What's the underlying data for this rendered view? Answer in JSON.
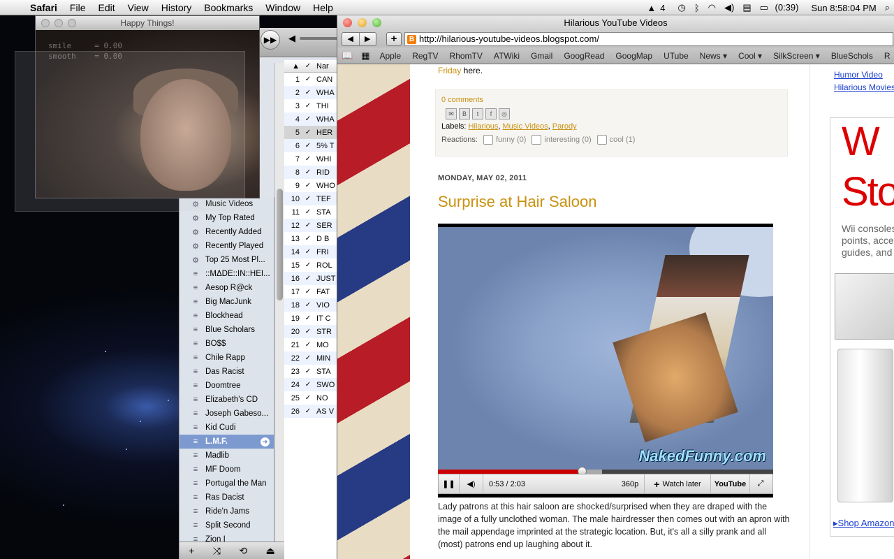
{
  "menubar": {
    "app": "Safari",
    "items": [
      "File",
      "Edit",
      "View",
      "History",
      "Bookmarks",
      "Window",
      "Help"
    ],
    "status": {
      "adobe_count": "4",
      "battery": "(0:39)",
      "clock": "Sun 8:58:04 PM"
    }
  },
  "photobooth": {
    "title": "Happy Things!",
    "overlay_line1": "smile     = 0.00",
    "overlay_line2": "smooth    = 0.00"
  },
  "itunes": {
    "controls": {
      "ff": "▶▶",
      "vol": "◀"
    },
    "sidebar": [
      {
        "icon": "gear",
        "label": "Music Videos"
      },
      {
        "icon": "gear",
        "label": "My Top Rated"
      },
      {
        "icon": "gear",
        "label": "Recently Added"
      },
      {
        "icon": "gear",
        "label": "Recently Played"
      },
      {
        "icon": "gear",
        "label": "Top 25 Most Pl..."
      },
      {
        "icon": "list",
        "label": "::MΔDE::IN::HEI..."
      },
      {
        "icon": "list",
        "label": "Aesop R@ck"
      },
      {
        "icon": "list",
        "label": "Big MacJunk"
      },
      {
        "icon": "list",
        "label": "Blockhead"
      },
      {
        "icon": "list",
        "label": "Blue Scholars"
      },
      {
        "icon": "list",
        "label": "BO$$"
      },
      {
        "icon": "list",
        "label": "Chile Rapp"
      },
      {
        "icon": "list",
        "label": "Das Racist"
      },
      {
        "icon": "list",
        "label": "Doomtree"
      },
      {
        "icon": "list",
        "label": "Elizabeth's CD"
      },
      {
        "icon": "list",
        "label": "Joseph Gabeso..."
      },
      {
        "icon": "list",
        "label": "Kid Cudi"
      },
      {
        "icon": "list",
        "label": "L.M.F.",
        "selected": true
      },
      {
        "icon": "list",
        "label": "Madlib"
      },
      {
        "icon": "list",
        "label": "MF Doom"
      },
      {
        "icon": "list",
        "label": "Portugal the Man"
      },
      {
        "icon": "list",
        "label": "Ras Dacist"
      },
      {
        "icon": "list",
        "label": "Ride'n Jams"
      },
      {
        "icon": "list",
        "label": "Split Second"
      },
      {
        "icon": "list",
        "label": "Zion I"
      }
    ],
    "track_header": "Nar",
    "tracks": [
      {
        "n": "1",
        "name": "CAN"
      },
      {
        "n": "2",
        "name": "WHA"
      },
      {
        "n": "3",
        "name": "THI"
      },
      {
        "n": "4",
        "name": "WHA"
      },
      {
        "n": "5",
        "name": "HER"
      },
      {
        "n": "6",
        "name": "5% T"
      },
      {
        "n": "7",
        "name": "WHI"
      },
      {
        "n": "8",
        "name": "RID"
      },
      {
        "n": "9",
        "name": "WHO"
      },
      {
        "n": "10",
        "name": "TEF"
      },
      {
        "n": "11",
        "name": "STA"
      },
      {
        "n": "12",
        "name": "SER"
      },
      {
        "n": "13",
        "name": "D B"
      },
      {
        "n": "14",
        "name": "FRI"
      },
      {
        "n": "15",
        "name": "ROL"
      },
      {
        "n": "16",
        "name": "JUST"
      },
      {
        "n": "17",
        "name": "FAT"
      },
      {
        "n": "18",
        "name": "VIO"
      },
      {
        "n": "19",
        "name": "IT C"
      },
      {
        "n": "20",
        "name": "STR"
      },
      {
        "n": "21",
        "name": "MO"
      },
      {
        "n": "22",
        "name": "MIN"
      },
      {
        "n": "23",
        "name": "STA"
      },
      {
        "n": "24",
        "name": "SWO"
      },
      {
        "n": "25",
        "name": "NO"
      },
      {
        "n": "26",
        "name": "AS V"
      }
    ],
    "bottom": [
      "+",
      "⤨",
      "⟲",
      "⏏"
    ]
  },
  "safari": {
    "title": "Hilarious YouTube Videos",
    "url": "http://hilarious-youtube-videos.blogspot.com/",
    "bookmarks": [
      "Apple",
      "RegTV",
      "RhomTV",
      "ATWiki",
      "Gmail",
      "GoogRead",
      "GoogMap",
      "UTube",
      "News ▾",
      "Cool ▾",
      "SilkScreen ▾",
      "BlueSchols",
      "R"
    ]
  },
  "blog": {
    "friday_link": "Friday",
    "friday_rest": " here.",
    "comments": "0 comments",
    "labels_prefix": "Labels: ",
    "labels": [
      "Hilarious",
      "Music Videos",
      "Parody"
    ],
    "reactions_label": "Reactions:",
    "reactions": [
      "funny (0)",
      "interesting (0)",
      "cool (1)"
    ],
    "date": "MONDAY, MAY 02, 2011",
    "post_title": "Surprise at Hair Saloon",
    "video": {
      "watermark": "NakedFunny.com",
      "time": "0:53 / 2:03",
      "quality": "360p",
      "watch_later": "Watch later",
      "youtube": "YouTube",
      "progress": 0.43,
      "loaded": 0.49
    },
    "description": "Lady patrons at this hair saloon are shocked/surprised when they are draped with the image of a fully unclothed woman. The male hairdresser then comes out with an apron with the mail appendage imprinted at the strategic location. But, it's all a silly prank and all (most) patrons end up laughing about it.",
    "sidebar_links": [
      "Humor Video",
      "Hilarious Movies"
    ],
    "ad": {
      "line1": "W",
      "line2": "Sto",
      "small1": "Wii consoles",
      "small2": "points, acce",
      "small3": "guides, and",
      "shop": "Shop Amazon."
    }
  }
}
